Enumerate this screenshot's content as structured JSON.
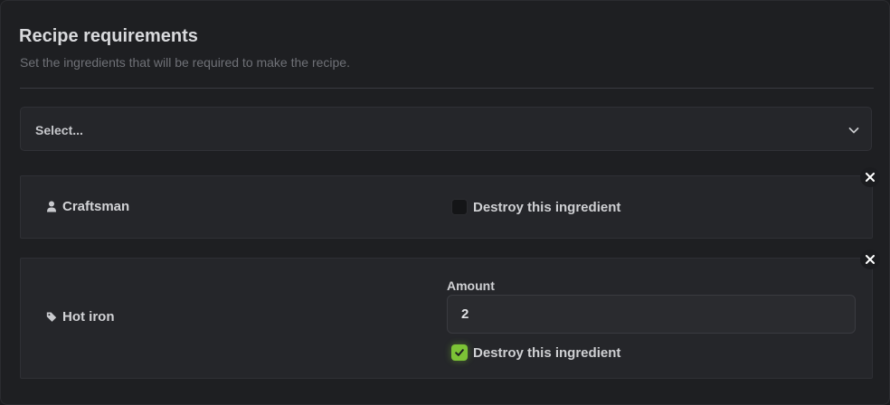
{
  "section": {
    "title": "Recipe requirements",
    "subtitle": "Set the ingredients that will be required to make the recipe."
  },
  "select": {
    "placeholder": "Select...",
    "icon": "chevron-down-icon"
  },
  "ingredients": [
    {
      "name": "Craftsman",
      "icon": "user-icon",
      "destroy_label": "Destroy this ingredient",
      "destroy_checked": false
    },
    {
      "name": "Hot iron",
      "icon": "tag-icon",
      "amount_label": "Amount",
      "amount_value": "2",
      "destroy_label": "Destroy this ingredient",
      "destroy_checked": true
    }
  ],
  "colors": {
    "accent": "#7cc336",
    "background": "#1e1f22",
    "card": "#25262a"
  }
}
